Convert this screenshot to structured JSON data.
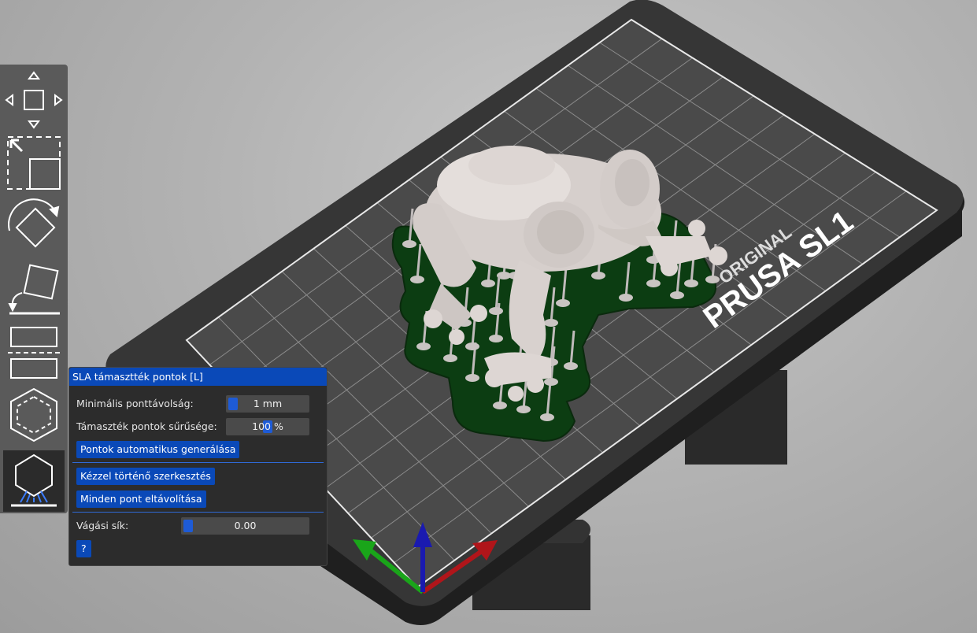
{
  "toolbar": {
    "tools": [
      {
        "name": "move-tool",
        "active": false
      },
      {
        "name": "scale-tool",
        "active": false
      },
      {
        "name": "rotate-tool",
        "active": false
      },
      {
        "name": "place-on-face-tool",
        "active": false
      },
      {
        "name": "cut-tool",
        "active": false
      },
      {
        "name": "hollow-tool",
        "active": false
      },
      {
        "name": "sla-support-points-tool",
        "active": true
      }
    ]
  },
  "bed": {
    "brand_text_line1": "ORIGINAL",
    "brand_text_line2": "PRUSA SL1",
    "bed_color": "#3d3d3d",
    "grid_color": "#8a8a8a"
  },
  "model": {
    "name": "frog",
    "color": "#d9d2cf",
    "support_pad_color": "#0c3d12"
  },
  "panel": {
    "title": "SLA támasztték pontok [L]",
    "min_distance_label": "Minimális ponttávolság:",
    "min_distance_value": "1 mm",
    "min_distance_fraction": 0.0,
    "density_label": "Támaszték pontok sűrűsége:",
    "density_value": "100 %",
    "density_fraction": 0.5,
    "auto_generate_button": "Pontok automatikus generálása",
    "manual_edit_button": "Kézzel történő szerkesztés",
    "remove_all_button": "Minden pont eltávolítása",
    "clipping_label": "Vágási sík:",
    "clipping_value": "0.00",
    "clipping_fraction": 0.0,
    "help_button": "?"
  },
  "colors": {
    "accent": "#0a49b8",
    "panel_bg": "#2c2c2c",
    "axis_x": "#b0151a",
    "axis_y": "#1aa51a",
    "axis_z": "#1a1ab0"
  }
}
